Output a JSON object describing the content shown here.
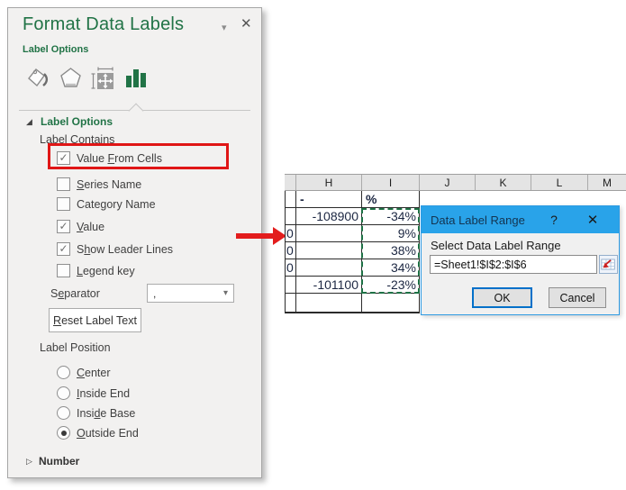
{
  "glyphs": {
    "caret_down": "▾",
    "close": "✕",
    "check": "✓",
    "section_expanded": "◢",
    "section_collapsed": "▷",
    "help": "?"
  },
  "pane": {
    "title": "Format Data Labels",
    "tab_label": "Label Options",
    "icons": [
      "fill-bucket-icon",
      "effects-pentagon-icon",
      "size-properties-icon",
      "chart-bars-icon"
    ],
    "section_label_options": "Label Options",
    "label_contains_heading": "Label Contains",
    "checkboxes": [
      {
        "pre": "Value ",
        "key": "F",
        "post": "rom Cells",
        "checked": true,
        "highlighted": true
      },
      {
        "pre": "",
        "key": "S",
        "post": "eries Name",
        "checked": false
      },
      {
        "pre": "",
        "key": "",
        "post": "Category Name",
        "checked": false
      },
      {
        "pre": "",
        "key": "V",
        "post": "alue",
        "checked": true
      },
      {
        "pre": "S",
        "key": "h",
        "post": "ow Leader Lines",
        "checked": true
      },
      {
        "pre": "",
        "key": "L",
        "post": "egend key",
        "checked": false
      }
    ],
    "separator": {
      "pre": "S",
      "key": "e",
      "post": "parator",
      "value": ","
    },
    "reset_button": {
      "pre": "",
      "key": "R",
      "post": "eset Label Text"
    },
    "label_position_heading": "Label Position",
    "radios": [
      {
        "pre": "",
        "key": "C",
        "post": "enter",
        "selected": false
      },
      {
        "pre": "",
        "key": "I",
        "post": "nside End",
        "selected": false
      },
      {
        "pre": "Insi",
        "key": "d",
        "post": "e Base",
        "selected": false
      },
      {
        "pre": "",
        "key": "O",
        "post": "utside End",
        "selected": true
      }
    ],
    "number_heading": "Number"
  },
  "sheet": {
    "col_headers": [
      "",
      "H",
      "I",
      "J",
      "K",
      "L",
      "M"
    ],
    "rows": [
      [
        "",
        "-",
        "%"
      ],
      [
        "",
        "-108900",
        "-34%"
      ],
      [
        "0",
        "",
        "9%"
      ],
      [
        "0",
        "",
        "38%"
      ],
      [
        "0",
        "",
        "34%"
      ],
      [
        "",
        "-101100",
        "-23%"
      ],
      [
        "",
        "",
        ""
      ]
    ],
    "selected_range_column": "I",
    "selection_color": "#1e7145"
  },
  "dialog": {
    "title": "Data Label Range",
    "label": "Select Data Label Range",
    "input_value": "=Sheet1!$I$2:$I$6",
    "ok_label": "OK",
    "cancel_label": "Cancel",
    "titlebar_color": "#29a3e9"
  },
  "colors": {
    "excel_green": "#217346",
    "annotation_red": "#e31d1d",
    "ok_focus_border": "#0070c9",
    "dialog_titlebar": "#29a3e9",
    "selection_green": "#1e7145"
  }
}
